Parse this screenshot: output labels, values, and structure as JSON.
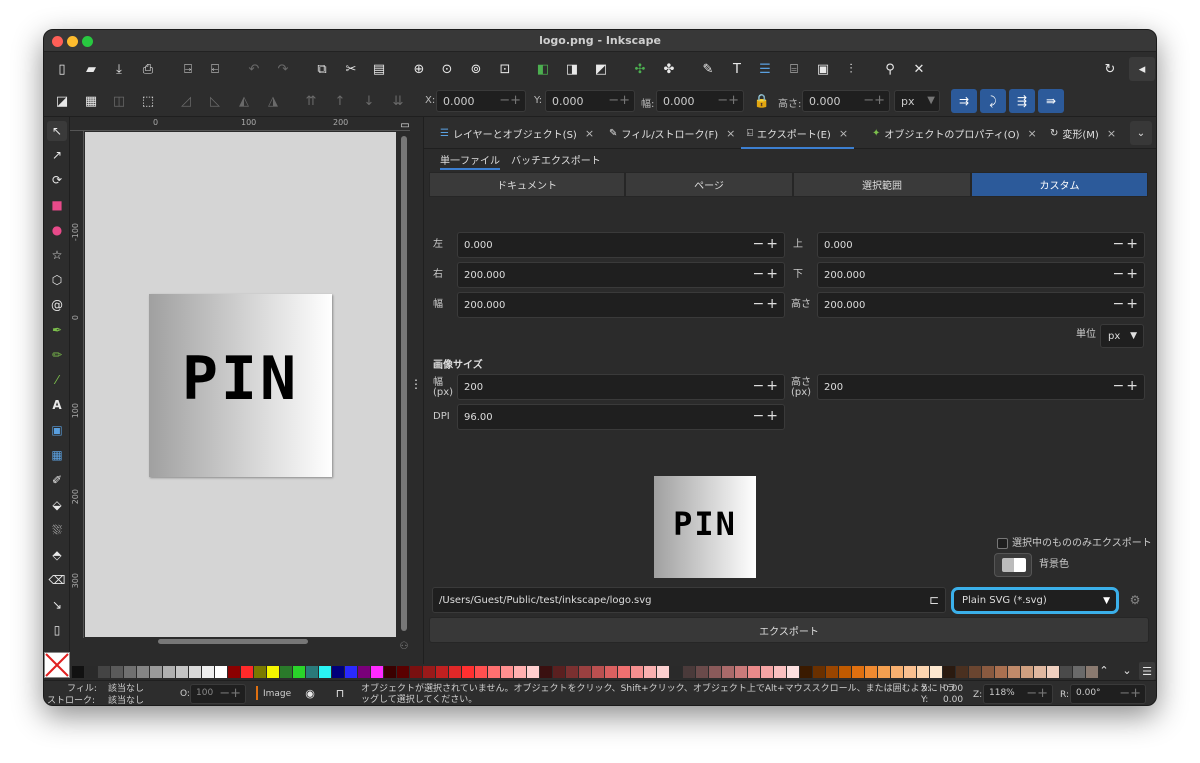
{
  "window": {
    "title": "logo.png - Inkscape"
  },
  "toolbar2": {
    "x_label": "X:",
    "x_value": "0.000",
    "y_label": "Y:",
    "y_value": "0.000",
    "w_label": "幅:",
    "w_value": "0.000",
    "h_label": "高さ:",
    "h_value": "0.000",
    "unit": "px"
  },
  "rulers": {
    "h": [
      "0",
      "100",
      "200"
    ],
    "v": [
      "-100",
      "0",
      "100",
      "200",
      "300"
    ]
  },
  "canvas": {
    "logo_text": "PIN"
  },
  "tabs": [
    {
      "label": "レイヤーとオブジェクト(S)",
      "icon": "layers-icon"
    },
    {
      "label": "フィル/ストローク(F)",
      "icon": "fill-stroke-icon"
    },
    {
      "label": "エクスポート(E)",
      "icon": "export-icon"
    },
    {
      "label": "オブジェクトのプロパティ(O)",
      "icon": "object-properties-icon"
    },
    {
      "label": "変形(M)",
      "icon": "transform-icon"
    }
  ],
  "export": {
    "subtabs": [
      "単一ファイル",
      "バッチエクスポート"
    ],
    "areas": [
      "ドキュメント",
      "ページ",
      "選択範囲",
      "カスタム"
    ],
    "selected_area": "カスタム",
    "left_label": "左",
    "left": "0.000",
    "top_label": "上",
    "top": "0.000",
    "right_label": "右",
    "right": "200.000",
    "bottom_label": "下",
    "bottom": "200.000",
    "width_label": "幅",
    "width": "200.000",
    "height_label": "高さ",
    "height": "200.000",
    "unit_label": "単位",
    "unit": "px",
    "image_size_heading": "画像サイズ",
    "px_width_label": "幅",
    "px_width_unit": "(px)",
    "px_width": "200",
    "px_height_label": "高さ",
    "px_height_unit": "(px)",
    "px_height": "200",
    "dpi_label": "DPI",
    "dpi": "96.00",
    "selected_only_label": "選択中のもののみエクスポート",
    "background_label": "背景色",
    "path": "/Users/Guest/Public/test/inkscape/logo.svg",
    "format": "Plain SVG (*.svg)",
    "export_button": "エクスポート"
  },
  "status": {
    "fill_label": "フィル:",
    "fill_value": "該当なし",
    "stroke_label": "ストローク:",
    "stroke_value": "該当なし",
    "opacity_label": "O:",
    "opacity_value": "100",
    "layer": "Image",
    "message": "オブジェクトが選択されていません。オブジェクトをクリック、Shift+クリック、オブジェクト上でAlt+マウススクロール、または囲むようにドラッグして選択してください。",
    "x_label": "X:",
    "x": "0.00",
    "y_label": "Y:",
    "y": "0.00",
    "zoom_label": "Z:",
    "zoom": "118%",
    "rotation_label": "R:",
    "rotation": "0.00°"
  },
  "palette": [
    "#111111",
    "#2a2a2a",
    "#444444",
    "#5a5a5a",
    "#707070",
    "#858585",
    "#9a9a9a",
    "#b0b0b0",
    "#c5c5c5",
    "#dadada",
    "#eeeeee",
    "#ffffff",
    "#8b0000",
    "#ff2a2a",
    "#7a7a00",
    "#f5f500",
    "#2a7a2a",
    "#2ad42a",
    "#2a7a7a",
    "#2af5f5",
    "#00007a",
    "#2a2aff",
    "#7a007a",
    "#ff2aff",
    "#3a0000",
    "#5a0000",
    "#7a1010",
    "#9a1a1a",
    "#c02020",
    "#e02828",
    "#ff3030",
    "#ff5050",
    "#ff7070",
    "#ff9090",
    "#ffb0b0",
    "#ffd0d0",
    "#3a1010",
    "#5a2020",
    "#7a3030",
    "#9a4040",
    "#ba5050",
    "#da6060",
    "#f07070",
    "#f59090",
    "#f9b0b0",
    "#fcd0d0",
    "#2a2a2a",
    "#4a3a3a",
    "#6a4a4a",
    "#8a5a5a",
    "#aa6a6a",
    "#ca7a7a",
    "#ea8a8a",
    "#f5a5a5",
    "#fac0c0",
    "#fde0e0",
    "#3a1a00",
    "#6a3000",
    "#9a4500",
    "#c05a00",
    "#e07010",
    "#f08a30",
    "#f5a050",
    "#f8b070",
    "#fac090",
    "#fcd5b0",
    "#fde8d0",
    "#2a1a10",
    "#4a3020",
    "#6a4530",
    "#8a5a40",
    "#aa7050",
    "#c08a6a",
    "#d0a080",
    "#e0b8a0",
    "#f0d0c0",
    "#4a4a4a",
    "#6a6a6a",
    "#8a7a70"
  ]
}
